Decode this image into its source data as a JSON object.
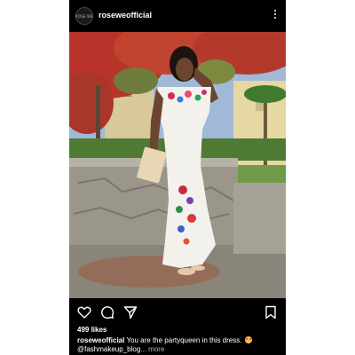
{
  "header": {
    "avatar_text": "ROSE.WE",
    "username": "roseweofficial"
  },
  "icons": {
    "more": "more-vertical-icon",
    "like": "heart-icon",
    "comment": "comment-icon",
    "share": "send-icon",
    "save": "bookmark-icon",
    "tagged": "user-tag-icon"
  },
  "post": {
    "likes": "499 likes",
    "caption_user": "roseweofficial",
    "caption_text": "You are the partyqueen in this dress.",
    "caption_line2": "@fashmakeup_blog",
    "more_label": "... more"
  },
  "colors": {
    "background": "#000000",
    "text": "#ffffff",
    "muted": "#b0b0b0"
  }
}
